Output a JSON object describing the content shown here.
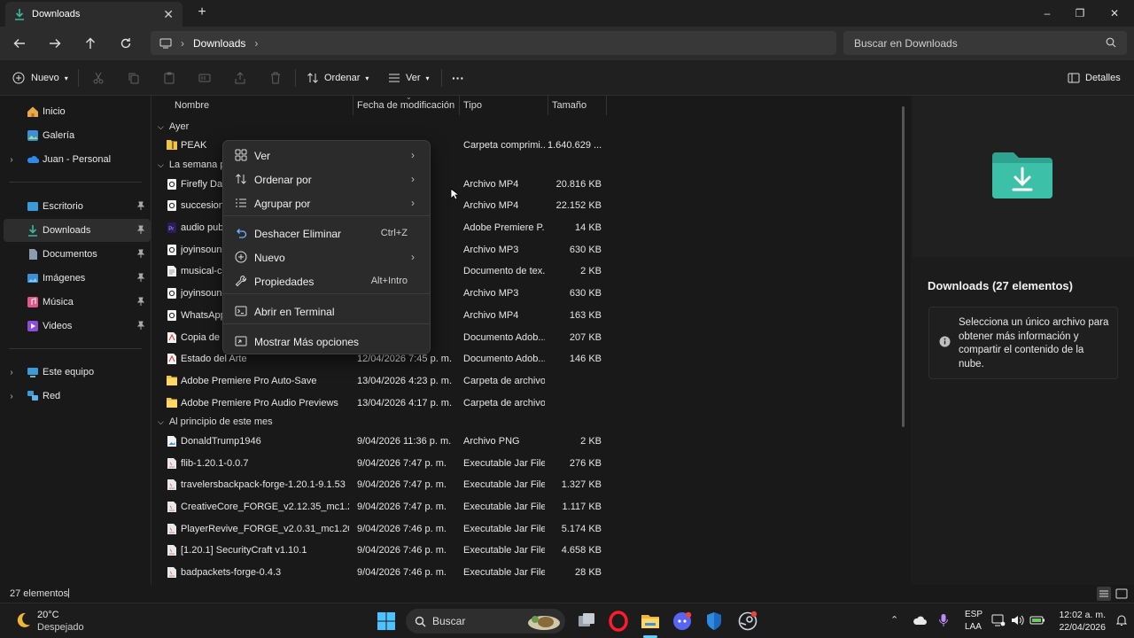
{
  "window": {
    "tab_title": "Downloads",
    "new_tab": "+",
    "minimize": "–",
    "maximize": "❐",
    "close": "✕"
  },
  "address": {
    "breadcrumb": "Downloads",
    "search_placeholder": "Buscar en Downloads"
  },
  "commandbar": {
    "new_label": "Nuevo",
    "sort_label": "Ordenar",
    "view_label": "Ver",
    "more_label": "···",
    "details_label": "Detalles"
  },
  "sidebar": {
    "items": [
      {
        "label": "Inicio",
        "icon": "home-icon"
      },
      {
        "label": "Galería",
        "icon": "gallery-icon"
      },
      {
        "label": "Juan - Personal",
        "icon": "onedrive-icon"
      },
      {
        "label": "Escritorio",
        "icon": "desktop-icon"
      },
      {
        "label": "Downloads",
        "icon": "download-icon"
      },
      {
        "label": "Documentos",
        "icon": "documents-icon"
      },
      {
        "label": "Imágenes",
        "icon": "pictures-icon"
      },
      {
        "label": "Música",
        "icon": "music-icon"
      },
      {
        "label": "Videos",
        "icon": "videos-icon"
      },
      {
        "label": "Este equipo",
        "icon": "pc-icon"
      },
      {
        "label": "Red",
        "icon": "network-icon"
      }
    ]
  },
  "filelist": {
    "headers": {
      "name": "Nombre",
      "date": "Fecha de modificación",
      "type": "Tipo",
      "size": "Tamaño"
    },
    "groups": [
      "Ayer",
      "La semana pa",
      "Al principio de este mes"
    ],
    "rows": [
      {
        "name": "PEAK",
        "date": "p. m.",
        "type": "Carpeta comprimi...",
        "size": "1.640.629 ..."
      },
      {
        "name": "Firefly Darl",
        "date": "p. m.",
        "type": "Archivo MP4",
        "size": "20.816 KB"
      },
      {
        "name": "succesion c",
        "date": "p. m.",
        "type": "Archivo MP4",
        "size": "22.152 KB"
      },
      {
        "name": "audio publ",
        "date": "p. m.",
        "type": "Adobe Premiere P...",
        "size": "14 KB"
      },
      {
        "name": "joyinsound",
        "date": "p. m.",
        "type": "Archivo MP3",
        "size": "630 KB"
      },
      {
        "name": "musical-co",
        "date": "p. m.",
        "type": "Documento de tex...",
        "size": "2 KB"
      },
      {
        "name": "joyinsound",
        "date": "p. m.",
        "type": "Archivo MP3",
        "size": "630 KB"
      },
      {
        "name": "WhatsApp",
        "date": "p. m.",
        "type": "Archivo MP4",
        "size": "163 KB"
      },
      {
        "name": "Copia de e",
        "date": "p. m.",
        "type": "Documento Adob...",
        "size": "207 KB"
      },
      {
        "name": "Estado del Arte",
        "date": "12/04/2026 7:45 p. m.",
        "type": "Documento Adob...",
        "size": "146 KB"
      },
      {
        "name": "Adobe Premiere Pro Auto-Save",
        "date": "13/04/2026 4:23 p. m.",
        "type": "Carpeta de archivos",
        "size": ""
      },
      {
        "name": "Adobe Premiere Pro Audio Previews",
        "date": "13/04/2026 4:17 p. m.",
        "type": "Carpeta de archivos",
        "size": ""
      },
      {
        "name": "DonaldTrump1946",
        "date": "9/04/2026 11:36 p. m.",
        "type": "Archivo PNG",
        "size": "2 KB"
      },
      {
        "name": "flib-1.20.1-0.0.7",
        "date": "9/04/2026 7:47 p. m.",
        "type": "Executable Jar File",
        "size": "276 KB"
      },
      {
        "name": "travelersbackpack-forge-1.20.1-9.1.53",
        "date": "9/04/2026 7:47 p. m.",
        "type": "Executable Jar File",
        "size": "1.327 KB"
      },
      {
        "name": "CreativeCore_FORGE_v2.12.35_mc1.20.1",
        "date": "9/04/2026 7:47 p. m.",
        "type": "Executable Jar File",
        "size": "1.117 KB"
      },
      {
        "name": "PlayerRevive_FORGE_v2.0.31_mc1.20.1",
        "date": "9/04/2026 7:46 p. m.",
        "type": "Executable Jar File",
        "size": "5.174 KB"
      },
      {
        "name": "[1.20.1] SecurityCraft v1.10.1",
        "date": "9/04/2026 7:46 p. m.",
        "type": "Executable Jar File",
        "size": "4.658 KB"
      },
      {
        "name": "badpackets-forge-0.4.3",
        "date": "9/04/2026 7:46 p. m.",
        "type": "Executable Jar File",
        "size": "28 KB"
      }
    ]
  },
  "context_menu": {
    "items": [
      {
        "label": "Ver",
        "shortcut": "",
        "submenu": true,
        "icon": "grid-icon"
      },
      {
        "label": "Ordenar por",
        "shortcut": "",
        "submenu": true,
        "icon": "sort-icon"
      },
      {
        "label": "Agrupar por",
        "shortcut": "",
        "submenu": true,
        "icon": "group-icon"
      },
      {
        "label": "Deshacer Eliminar",
        "shortcut": "Ctrl+Z",
        "submenu": false,
        "icon": "undo-icon"
      },
      {
        "label": "Nuevo",
        "shortcut": "",
        "submenu": true,
        "icon": "new-icon"
      },
      {
        "label": "Propiedades",
        "shortcut": "Alt+Intro",
        "submenu": false,
        "icon": "wrench-icon"
      },
      {
        "label": "Abrir en Terminal",
        "shortcut": "",
        "submenu": false,
        "icon": "terminal-icon"
      },
      {
        "label": "Mostrar Más opciones",
        "shortcut": "",
        "submenu": false,
        "icon": "more-options-icon"
      }
    ]
  },
  "details": {
    "title": "Downloads (27 elementos)",
    "info": "Selecciona un único archivo para obtener más información y compartir el contenido de la nube."
  },
  "status": {
    "count": "27 elementos",
    "cursor": "|"
  },
  "taskbar": {
    "weather_temp": "20°C",
    "weather_desc": "Despejado",
    "search_label": "Buscar",
    "lang_1": "ESP",
    "lang_2": "LAA",
    "time": "12:02 a. m.",
    "date": "22/04/2026"
  },
  "colors": {
    "accent": "#3fb5a0",
    "folder": "#f0c44a"
  }
}
